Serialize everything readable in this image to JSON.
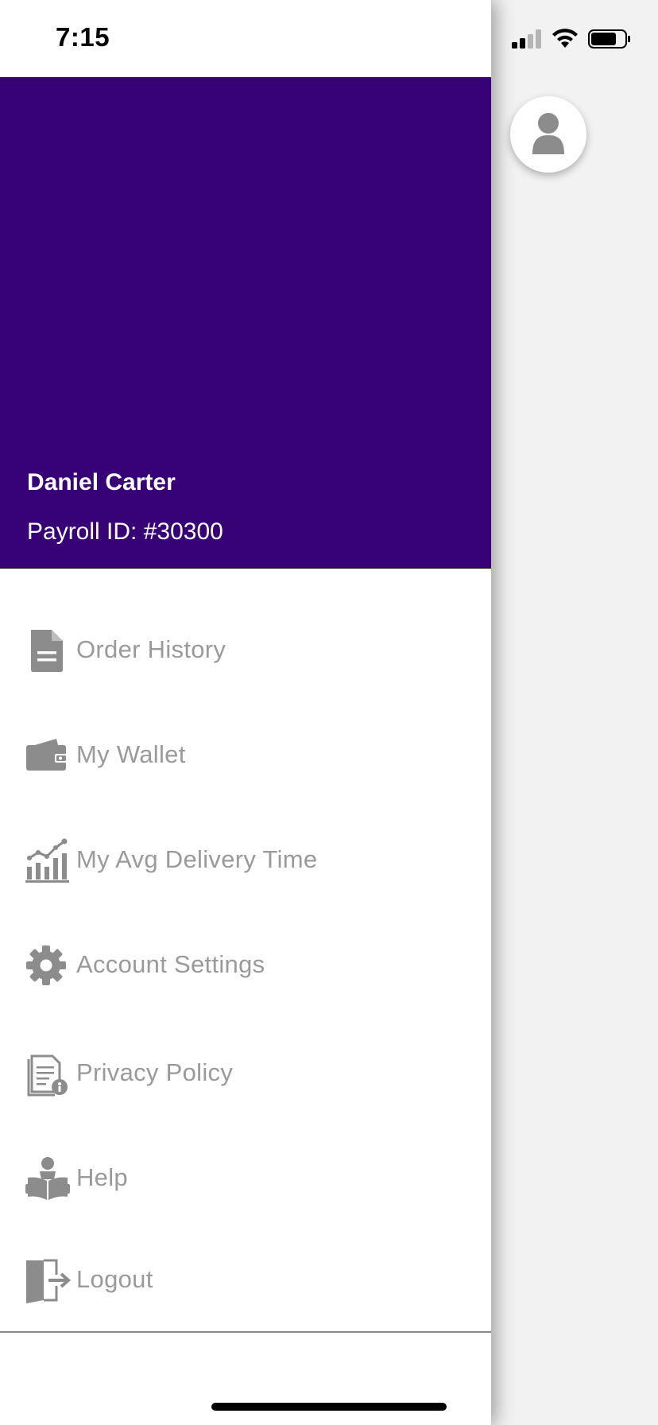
{
  "status_bar": {
    "time": "7:15",
    "icons": [
      "cellular-signal-icon",
      "wifi-icon",
      "battery-icon"
    ]
  },
  "drawer": {
    "header_color": "#360275",
    "user_name": "Daniel Carter",
    "payroll_id": "Payroll ID: #30300",
    "menu": [
      {
        "label": "Order History",
        "icon": "document-icon"
      },
      {
        "label": "My Wallet",
        "icon": "wallet-icon"
      },
      {
        "label": "My Avg Delivery Time",
        "icon": "bar-chart-icon"
      },
      {
        "label": "Account Settings",
        "icon": "gear-icon"
      },
      {
        "label": "Privacy Policy",
        "icon": "privacy-document-icon"
      },
      {
        "label": "Help",
        "icon": "reader-icon"
      },
      {
        "label": "Logout",
        "icon": "logout-door-icon"
      }
    ]
  },
  "background": {
    "avatar_icon": "user-avatar-icon"
  },
  "colors": {
    "accent": "#360275",
    "menu_text": "#9a9a9a",
    "icon": "#8c8c8c",
    "background": "#f2f2f2"
  }
}
